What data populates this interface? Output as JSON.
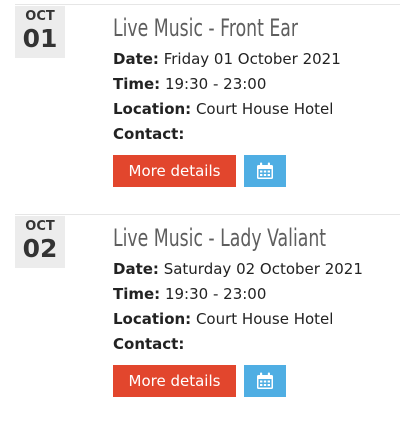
{
  "events": [
    {
      "month": "OCT",
      "day": "01",
      "title": "Live Music - Front Ear",
      "date_label": "Date:",
      "date_value": "Friday 01 October 2021",
      "time_label": "Time:",
      "time_value": "19:30 - 23:00",
      "location_label": "Location:",
      "location_value": "Court House Hotel",
      "contact_label": "Contact:",
      "contact_value": "",
      "more_button": "More details",
      "calendar_icon": "calendar-icon"
    },
    {
      "month": "OCT",
      "day": "02",
      "title": "Live Music - Lady Valiant",
      "date_label": "Date:",
      "date_value": "Saturday 02 October 2021",
      "time_label": "Time:",
      "time_value": "19:30 - 23:00",
      "location_label": "Location:",
      "location_value": "Court House Hotel",
      "contact_label": "Contact:",
      "contact_value": "",
      "more_button": "More details",
      "calendar_icon": "calendar-icon"
    }
  ],
  "colors": {
    "more_button_bg": "#e2462d",
    "calendar_button_bg": "#4faee3",
    "date_badge_bg": "#ececec",
    "title_text": "#5e5e5e"
  }
}
